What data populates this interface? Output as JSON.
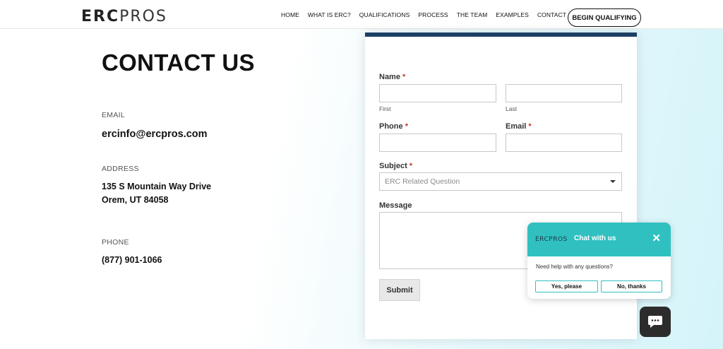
{
  "header": {
    "logo_bold": "ERC",
    "logo_light": "PROS",
    "nav": [
      "HOME",
      "WHAT IS ERC?",
      "QUALIFICATIONS",
      "PROCESS",
      "THE TEAM",
      "EXAMPLES",
      "CONTACT"
    ],
    "cta_label": "BEGIN QUALIFYING"
  },
  "contact": {
    "title": "CONTACT US",
    "email_label": "EMAIL",
    "email_value": "ercinfo@ercpros.com",
    "address_label": "ADDRESS",
    "address_line1": "135 S Mountain Way Drive",
    "address_line2": "Orem, UT 84058",
    "phone_label": "PHONE",
    "phone_value": "(877) 901-1066"
  },
  "form": {
    "name_label": "Name",
    "phone_label": "Phone",
    "email_label": "Email",
    "subject_label": "Subject",
    "message_label": "Message",
    "required_mark": "*",
    "first_sub": "First",
    "last_sub": "Last",
    "subject_selected": "ERC Related Question",
    "submit_label": "Submit"
  },
  "chat": {
    "logo": "ERCPROS",
    "title": "Chat with us",
    "close": "✕",
    "message": "Need help with any questions?",
    "yes_label": "Yes, please",
    "no_label": "No, thanks"
  },
  "colors": {
    "accent_teal": "#31c0c0",
    "card_top_border": "#1d3f66",
    "required": "#c0392b"
  },
  "icons": {
    "chat_fab": "chat-bubble-icon",
    "select": "chevron-down-icon",
    "close": "close-icon"
  }
}
